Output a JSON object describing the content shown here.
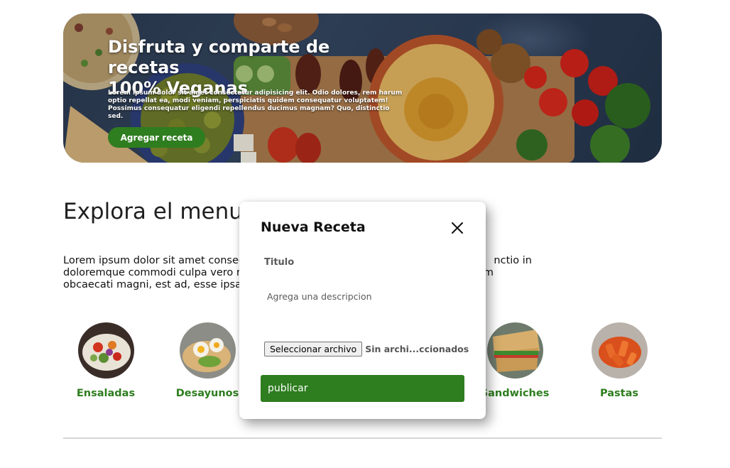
{
  "hero": {
    "title_line1": "Disfruta y comparte de recetas",
    "title_line2": "100% Veganas",
    "text": "Lorem ipsum dolor sit amet consectetur adipisicing elit. Odio dolores, rem harum optio repellat ea, modi veniam, perspiciatis quidem consequatur voluptatem! Possimus consequatur eligendi repellendus ducimus magnam? Quo, distinctio sed.",
    "button_label": "Agregar receta"
  },
  "explore": {
    "title": "Explora el menu",
    "text_line1": "Lorem ipsum dolor sit amet consec",
    "text_line1_end": "nctio in",
    "text_line2": "doloremque commodi culpa vero re",
    "text_line2_end": "m",
    "text_line3": "obcaecati magni, est ad, esse ipsa i",
    "categories": [
      {
        "label": "Ensaladas"
      },
      {
        "label": "Desayunos"
      },
      {
        "label": "Sandwiches"
      },
      {
        "label": "Pastas"
      }
    ]
  },
  "modal": {
    "title": "Nueva Receta",
    "title_placeholder": "Titulo",
    "description_placeholder": "Agrega una descripcion",
    "file_button_label": "Seleccionar archivo",
    "file_status": "Sin archi...ccionados",
    "publish_label": "publicar"
  },
  "colors": {
    "accent_green": "#2e7d1f",
    "hero_bg": "#2b3b52"
  },
  "icons": {
    "close": "close-icon"
  }
}
